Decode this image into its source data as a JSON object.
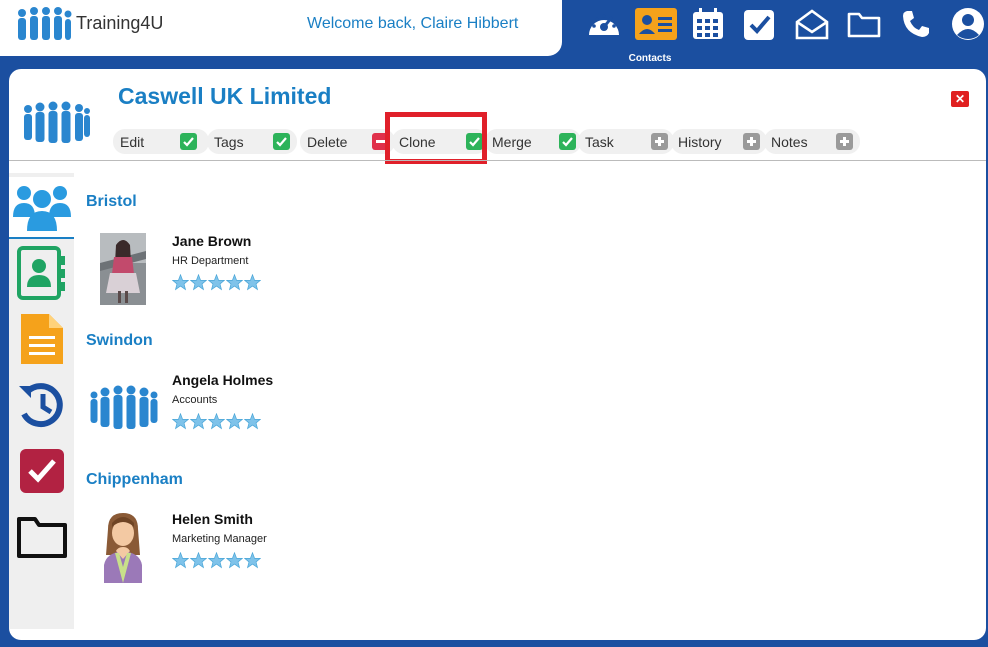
{
  "header": {
    "logo_text": "Training4U",
    "welcome": "Welcome back, Claire Hibbert"
  },
  "topnav": {
    "items": [
      {
        "icon": "dashboard-gauge-icon"
      },
      {
        "icon": "contacts-card-icon",
        "label": "Contacts",
        "active": true
      },
      {
        "icon": "calendar-icon"
      },
      {
        "icon": "tasks-check-icon"
      },
      {
        "icon": "mail-envelope-icon"
      },
      {
        "icon": "folder-icon"
      },
      {
        "icon": "phone-icon"
      },
      {
        "icon": "user-account-icon"
      }
    ]
  },
  "company": {
    "name": "Caswell UK Limited"
  },
  "actions": [
    {
      "label": "Edit",
      "state": "check"
    },
    {
      "label": "Tags",
      "state": "check"
    },
    {
      "label": "Delete",
      "state": "minus"
    },
    {
      "label": "Clone",
      "state": "check"
    },
    {
      "label": "Merge",
      "state": "check"
    },
    {
      "label": "Task",
      "state": "plus"
    },
    {
      "label": "History",
      "state": "plus"
    },
    {
      "label": "Notes",
      "state": "plus"
    }
  ],
  "leftnav": [
    {
      "icon": "people-group-icon",
      "active": true
    },
    {
      "icon": "address-book-icon"
    },
    {
      "icon": "document-icon"
    },
    {
      "icon": "history-icon"
    },
    {
      "icon": "task-check-icon"
    },
    {
      "icon": "folder-icon"
    }
  ],
  "groups": [
    {
      "location": "Bristol",
      "contacts": [
        {
          "name": "Jane Brown",
          "department": "HR Department",
          "rating": 5,
          "avatar": "photo"
        }
      ]
    },
    {
      "location": "Swindon",
      "contacts": [
        {
          "name": "Angela Holmes",
          "department": "Accounts",
          "rating": 5,
          "avatar": "group"
        }
      ]
    },
    {
      "location": "Chippenham",
      "contacts": [
        {
          "name": "Helen Smith",
          "department": "Marketing Manager",
          "rating": 5,
          "avatar": "female"
        }
      ]
    }
  ],
  "colors": {
    "brand_blue": "#1b4fa0",
    "title_blue": "#1a7fc4",
    "check_green": "#2db35a",
    "minus_red": "#e0304a",
    "plus_grey": "#9a9a9a",
    "highlight_red": "#e0202a",
    "contacts_orange": "#f5a21b"
  }
}
